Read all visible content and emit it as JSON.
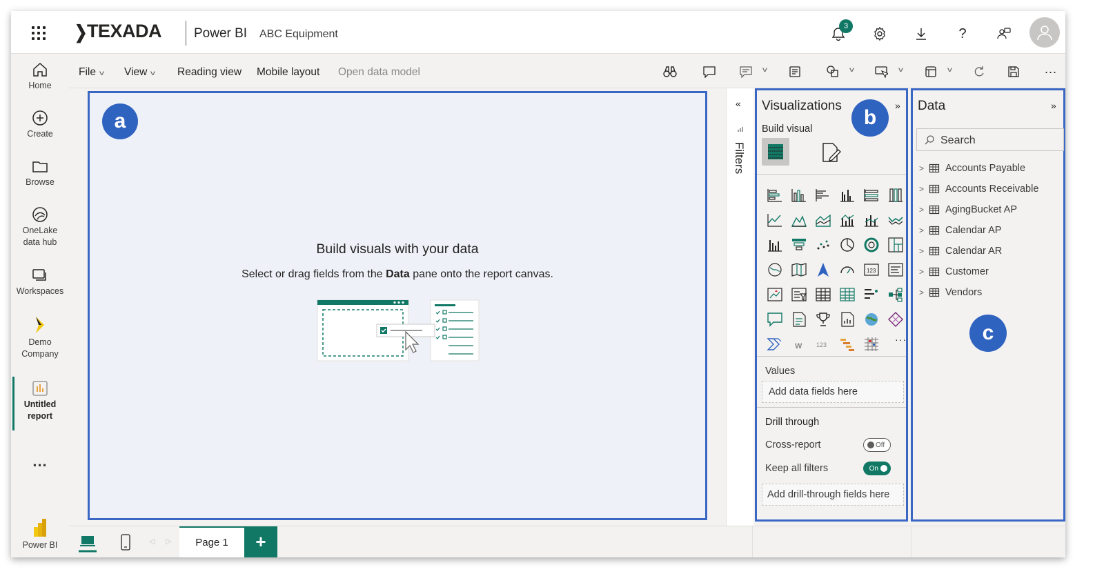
{
  "header": {
    "brand": "TEXADA",
    "app_name": "Power BI",
    "workspace": "ABC Equipment",
    "notification_count": "3"
  },
  "nav": {
    "items": [
      {
        "label": "Home"
      },
      {
        "label": "Create"
      },
      {
        "label": "Browse"
      },
      {
        "label": "OneLake data hub"
      },
      {
        "label": "Workspaces"
      },
      {
        "label": "Demo Company"
      },
      {
        "label": "Untitled report"
      }
    ],
    "more": "...",
    "footer": "Power BI"
  },
  "ribbon": {
    "file": "File",
    "view": "View",
    "reading_view": "Reading view",
    "mobile_layout": "Mobile layout",
    "open_data_model": "Open data model",
    "more": "..."
  },
  "canvas": {
    "label": "a",
    "title": "Build visuals with your data",
    "subtitle_pre": "Select or drag fields from the ",
    "subtitle_bold": "Data",
    "subtitle_post": " pane onto the report canvas."
  },
  "filters": {
    "label": "Filters"
  },
  "viz": {
    "title": "Visualizations",
    "label": "b",
    "build_visual": "Build visual",
    "values": "Values",
    "add_data_fields": "Add data fields here",
    "drill_through": "Drill through",
    "cross_report": "Cross-report",
    "cross_report_state": "Off",
    "keep_all_filters": "Keep all filters",
    "keep_all_filters_state": "On",
    "add_drill_fields": "Add drill-through fields here",
    "more_visuals": "···"
  },
  "data_pane": {
    "title": "Data",
    "label": "c",
    "search_placeholder": "Search",
    "tables": [
      "Accounts Payable",
      "Accounts Receivable",
      "AgingBucket AP",
      "Calendar AP",
      "Calendar AR",
      "Customer",
      "Vendors"
    ]
  },
  "pages": {
    "tab": "Page 1",
    "add": "+"
  },
  "colors": {
    "accent": "#117865",
    "highlight": "#3a67c4",
    "label_circle": "#2f63c0"
  }
}
